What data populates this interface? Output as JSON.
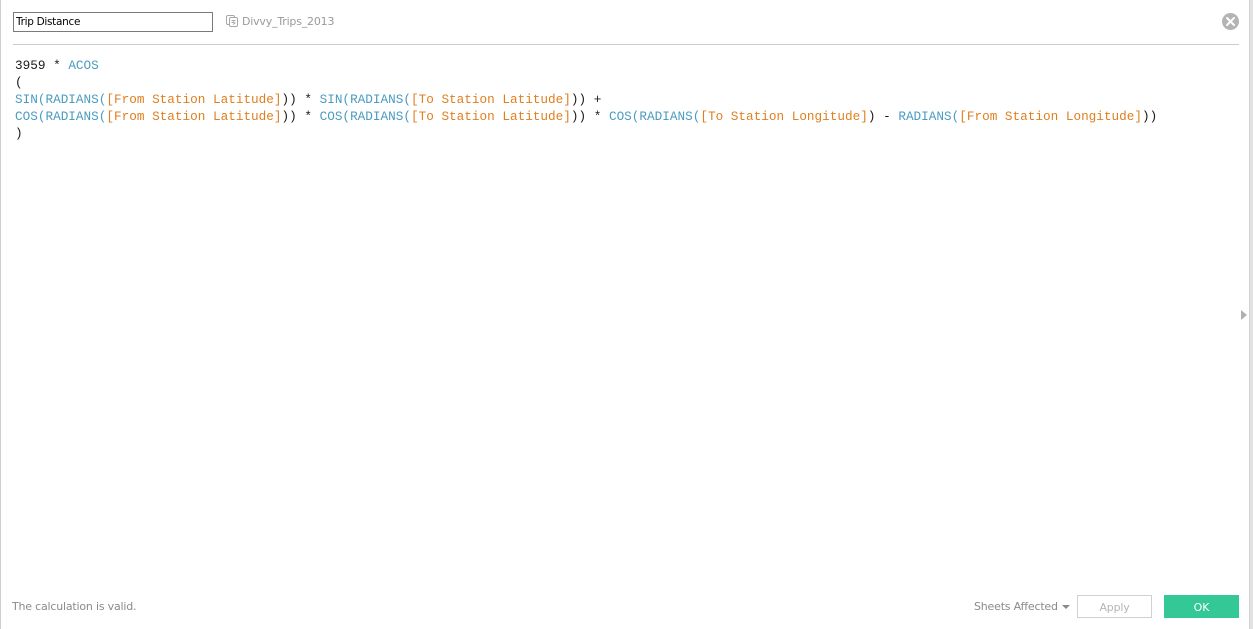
{
  "calculation": {
    "name": "Trip Distance",
    "datasource": "Divvy_Trips_2013",
    "datasource_icon": "datasource-icon",
    "close_icon": "close-icon"
  },
  "formula": {
    "lines": [
      [
        {
          "type": "num",
          "text": "3959"
        },
        {
          "type": "op",
          "text": " * "
        },
        {
          "type": "fn",
          "text": "ACOS"
        }
      ],
      [
        {
          "type": "op",
          "text": "("
        }
      ],
      [
        {
          "type": "fn",
          "text": "SIN("
        },
        {
          "type": "fn",
          "text": "RADIANS("
        },
        {
          "type": "field",
          "text": "[From Station Latitude]"
        },
        {
          "type": "op",
          "text": ")) * "
        },
        {
          "type": "fn",
          "text": "SIN("
        },
        {
          "type": "fn",
          "text": "RADIANS("
        },
        {
          "type": "field",
          "text": "[To Station Latitude]"
        },
        {
          "type": "op",
          "text": ")) +"
        }
      ],
      [
        {
          "type": "fn",
          "text": "COS("
        },
        {
          "type": "fn",
          "text": "RADIANS("
        },
        {
          "type": "field",
          "text": "[From Station Latitude]"
        },
        {
          "type": "op",
          "text": ")) * "
        },
        {
          "type": "fn",
          "text": "COS("
        },
        {
          "type": "fn",
          "text": "RADIANS("
        },
        {
          "type": "field",
          "text": "[To Station Latitude]"
        },
        {
          "type": "op",
          "text": ")) * "
        },
        {
          "type": "fn",
          "text": "COS("
        },
        {
          "type": "fn",
          "text": "RADIANS("
        },
        {
          "type": "field",
          "text": "[To Station Longitude]"
        },
        {
          "type": "op",
          "text": ") - "
        },
        {
          "type": "fn",
          "text": "RADIANS("
        },
        {
          "type": "field",
          "text": "[From Station Longitude]"
        },
        {
          "type": "op",
          "text": "))"
        }
      ],
      [
        {
          "type": "op",
          "text": ")"
        }
      ]
    ]
  },
  "footer": {
    "status": "The calculation is valid.",
    "sheets_affected": "Sheets Affected",
    "apply_label": "Apply",
    "ok_label": "OK"
  },
  "colors": {
    "function": "#4a9bc0",
    "field": "#e07f1f",
    "ok_button": "#34c896"
  },
  "side_panel_toggle_icon": "expand-right-icon"
}
